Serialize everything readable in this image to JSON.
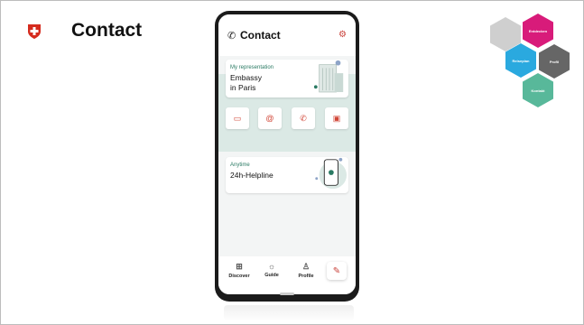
{
  "slide": {
    "title": "Contact"
  },
  "hexagons": [
    {
      "label": "",
      "color": "#cfcfcf"
    },
    {
      "label": "Entdecken",
      "color": "#d81b7a"
    },
    {
      "label": "Reiseplan",
      "color": "#2aa9df"
    },
    {
      "label": "Profil",
      "color": "#666666"
    },
    {
      "label": "Kontakt",
      "color": "#58b89a"
    }
  ],
  "app": {
    "header_title": "Contact",
    "representation": {
      "label": "My representation",
      "name_line1": "Embassy",
      "name_line2": "in Paris"
    },
    "helpline": {
      "label": "Anytime",
      "title": "24h-Helpline"
    },
    "actions": [
      "chat-icon",
      "email-icon",
      "phone-icon",
      "calendar-icon"
    ],
    "nav": {
      "discover": "Discover",
      "guide": "Guide",
      "profile": "Profile"
    }
  },
  "colors": {
    "accent": "#c9423b",
    "green": "#2a7a63"
  }
}
